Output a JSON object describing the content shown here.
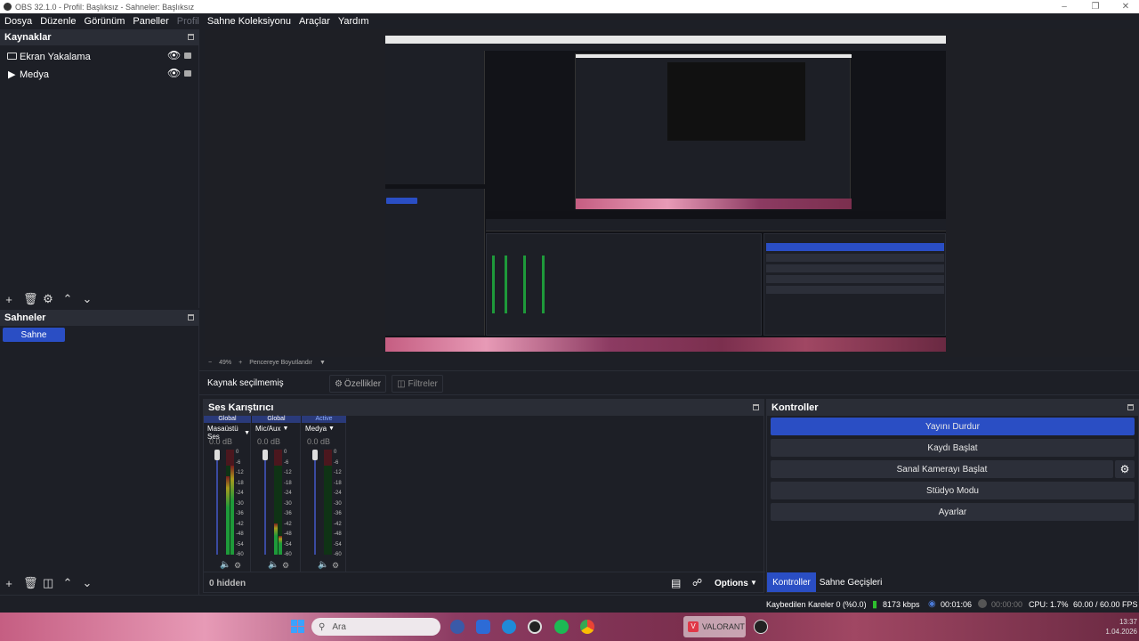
{
  "window": {
    "title": "OBS 32.1.0 - Profil: Başlıksız - Sahneler: Başlıksız"
  },
  "menu": [
    "Dosya",
    "Düzenle",
    "Görünüm",
    "Paneller",
    "Profil",
    "Sahne Koleksiyonu",
    "Araçlar",
    "Yardım"
  ],
  "sources": {
    "title": "Kaynaklar",
    "items": [
      {
        "name": "Ekran Yakalama",
        "icon": "monitor-icon"
      },
      {
        "name": "Medya",
        "icon": "play-icon"
      }
    ]
  },
  "scenes": {
    "title": "Sahneler",
    "items": [
      "Sahne"
    ]
  },
  "preview": {
    "zoom": "49%",
    "fit_label": "Pencereye Boyutlandır"
  },
  "context_bar": {
    "no_source": "Kaynak seçilmemiş",
    "properties": "Özellikler",
    "filters": "Filtreler"
  },
  "mixer": {
    "title": "Ses Karıştırıcı",
    "channels": [
      {
        "tag": "Global",
        "name": "Masaüstü Ses",
        "db": "0.0 dB"
      },
      {
        "tag": "Global",
        "name": "Mic/Aux",
        "db": "0.0 dB"
      },
      {
        "tag": "Active",
        "name": "Medya",
        "db": "0.0 dB"
      }
    ],
    "scale": [
      "0",
      "-6",
      "-12",
      "-18",
      "-24",
      "-30",
      "-36",
      "-42",
      "-48",
      "-54",
      "-60"
    ],
    "hidden": "0 hidden",
    "options": "Options"
  },
  "controls": {
    "title": "Kontroller",
    "stream": "Yayını Durdur",
    "record": "Kaydı Başlat",
    "virtualcam": "Sanal Kamerayı Başlat",
    "studio": "Stüdyo Modu",
    "settings": "Ayarlar",
    "tab_controls": "Kontroller",
    "tab_transitions": "Sahne Geçişleri"
  },
  "status": {
    "dropped": "Kaybedilen Kareler 0 (%0.0)",
    "bitrate": "8173 kbps",
    "stream_time": "00:01:06",
    "rec_time": "00:00:00",
    "cpu": "CPU: 1.7%",
    "fps": "60.00 / 60.00 FPS"
  },
  "taskbar": {
    "search": "Ara",
    "valorant": "VALORANT",
    "time": "13:37",
    "date": "1.04.2026"
  },
  "colors": {
    "accent": "#2a4ec4",
    "bg": "#1d1f26",
    "panel_header": "#2a2d36"
  }
}
